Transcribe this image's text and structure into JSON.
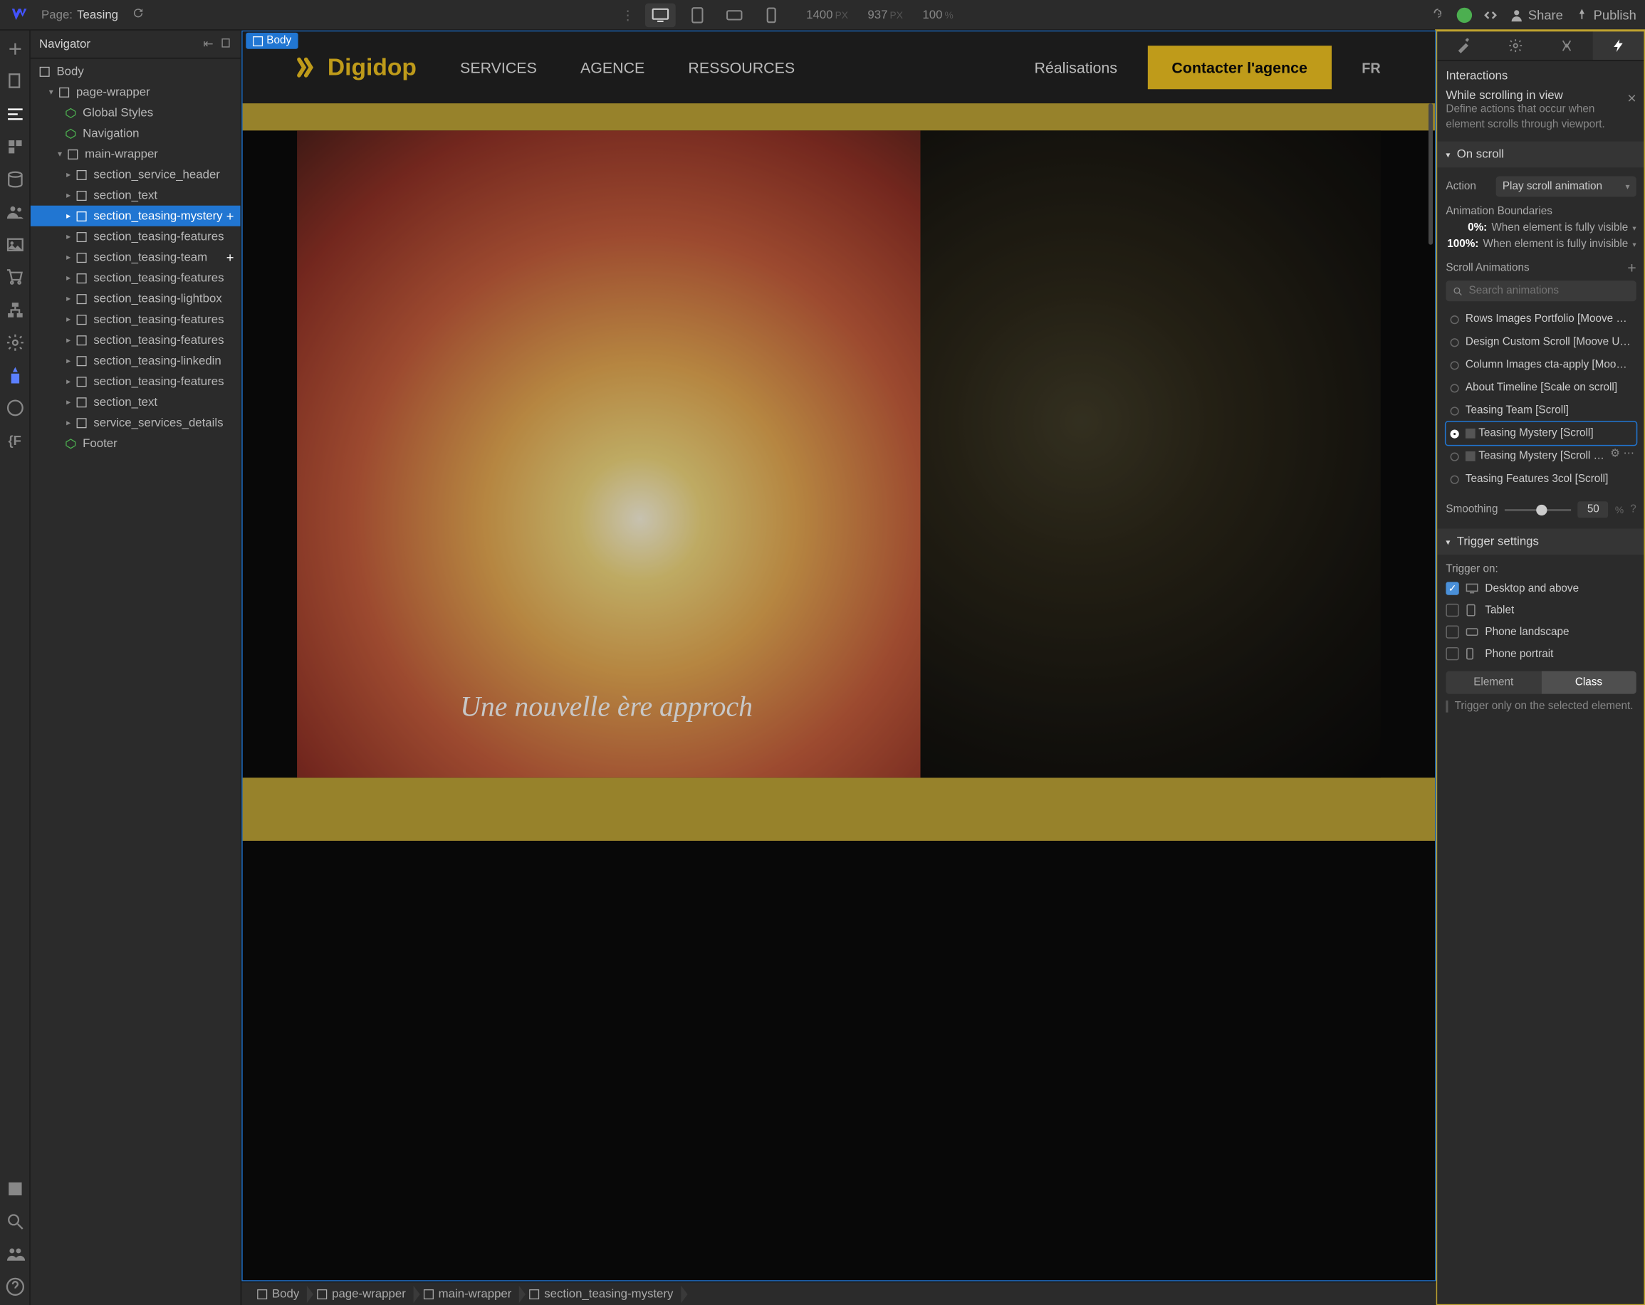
{
  "topbar": {
    "page_label": "Page:",
    "page_name": "Teasing",
    "canvas_w": "1400",
    "canvas_h": "937",
    "zoom": "100",
    "px": "PX",
    "pct": "%",
    "share": "Share",
    "publish": "Publish"
  },
  "navigator": {
    "title": "Navigator",
    "tree": {
      "body": "Body",
      "page_wrapper": "page-wrapper",
      "global_styles": "Global Styles",
      "navigation": "Navigation",
      "main_wrapper": "main-wrapper",
      "items": [
        "section_service_header",
        "section_text",
        "section_teasing-mystery",
        "section_teasing-features",
        "section_teasing-team",
        "section_teasing-features",
        "section_teasing-lightbox",
        "section_teasing-features",
        "section_teasing-features",
        "section_teasing-linkedin",
        "section_teasing-features",
        "section_text",
        "service_services_details"
      ],
      "footer": "Footer"
    }
  },
  "canvas": {
    "selection_chip": "Body",
    "nav": {
      "logo": "Digidop",
      "links": [
        "SERVICES",
        "AGENCE",
        "RESSOURCES"
      ],
      "realisations": "Réalisations",
      "cta": "Contacter l'agence",
      "lang": "FR"
    },
    "hero_text": "Une nouvelle ère approch"
  },
  "breadcrumb": [
    "Body",
    "page-wrapper",
    "main-wrapper",
    "section_teasing-mystery"
  ],
  "interactions": {
    "title": "Interactions",
    "trigger_title": "While scrolling in view",
    "trigger_desc": "Define actions that occur when element scrolls through viewport.",
    "on_scroll": "On scroll",
    "action_label": "Action",
    "action_value": "Play scroll animation",
    "boundaries_label": "Animation Boundaries",
    "b0_pct": "0%:",
    "b0_txt": "When element is fully visible",
    "b100_pct": "100%:",
    "b100_txt": "When element is fully invisible",
    "scroll_anim_label": "Scroll Animations",
    "search_placeholder": "Search animations",
    "animations": [
      "Rows Images Portfolio [Moove Lef…",
      "Design Custom Scroll [Moove Up …",
      "Column Images cta-apply [Moove…",
      "About Timeline [Scale on scroll]",
      "Teasing Team [Scroll]",
      "Teasing Mystery [Scroll]",
      "Teasing Mystery [Scroll …",
      "Teasing Features 3col [Scroll]"
    ],
    "smoothing_label": "Smoothing",
    "smoothing_value": "50",
    "trigger_settings": "Trigger settings",
    "trigger_on": "Trigger on:",
    "devices": [
      "Desktop and above",
      "Tablet",
      "Phone landscape",
      "Phone portrait"
    ],
    "seg_element": "Element",
    "seg_class": "Class",
    "hint": "Trigger only on the selected element."
  }
}
